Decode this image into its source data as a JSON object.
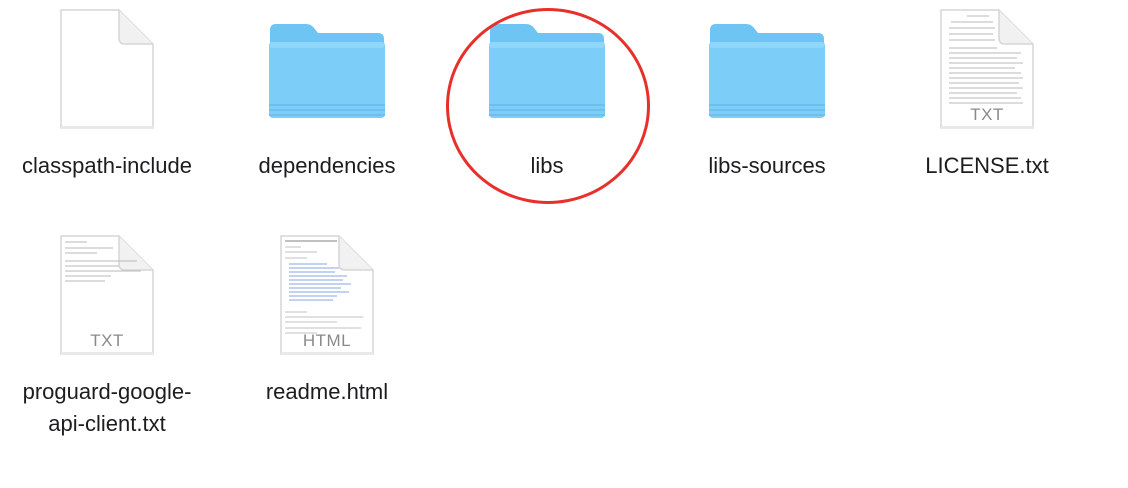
{
  "files": [
    {
      "label": "classpath-include",
      "kind": "document",
      "icon": "blank-document-icon",
      "ext": ""
    },
    {
      "label": "dependencies",
      "kind": "folder",
      "icon": "folder-icon"
    },
    {
      "label": "libs",
      "kind": "folder",
      "icon": "folder-icon"
    },
    {
      "label": "libs-sources",
      "kind": "folder",
      "icon": "folder-icon"
    },
    {
      "label": "LICENSE.txt",
      "kind": "document",
      "icon": "text-document-icon",
      "ext": "TXT"
    },
    {
      "label": "proguard-google-api-client.txt",
      "label_line1": "proguard-google-",
      "label_line2": "api-client.txt",
      "kind": "document",
      "icon": "text-document-icon",
      "ext": "TXT"
    },
    {
      "label": "readme.html",
      "kind": "document",
      "icon": "html-document-icon",
      "ext": "HTML"
    }
  ],
  "colors": {
    "folder_top": "#7fd0f9",
    "folder_body": "#78c9f5",
    "highlight": "#e8302b",
    "label_text": "#1d1d1f"
  }
}
